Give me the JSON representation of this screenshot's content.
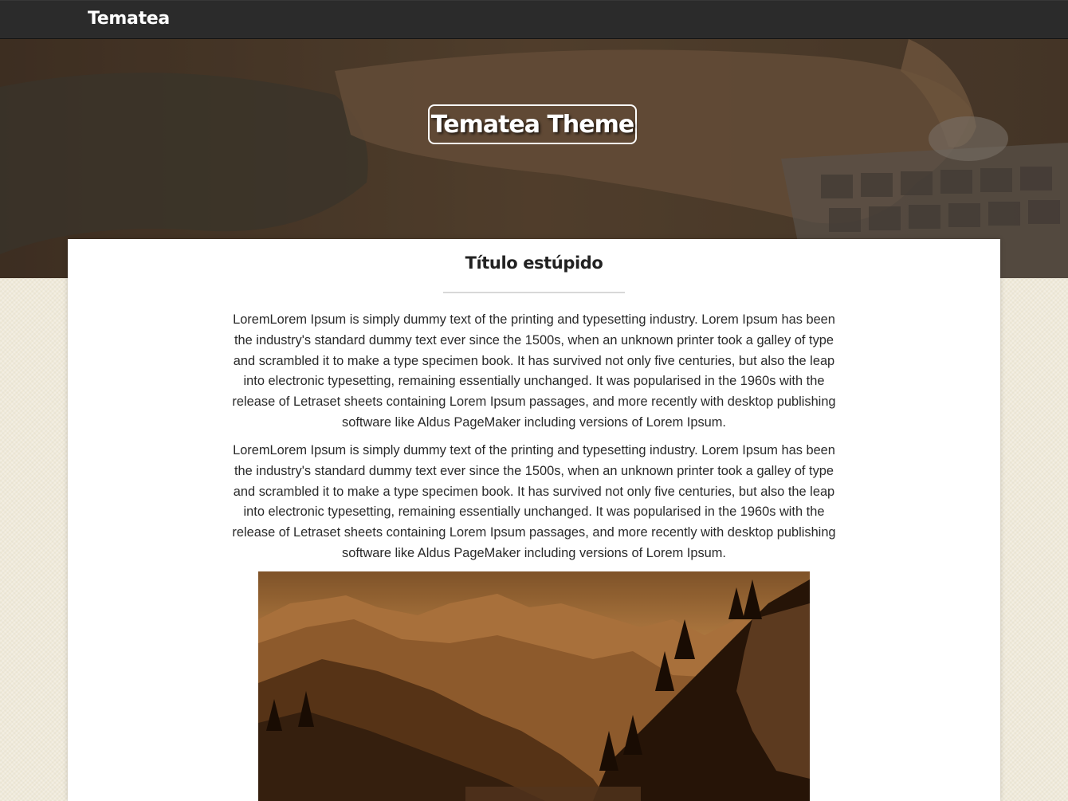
{
  "nav": {
    "brand": "Tematea"
  },
  "hero": {
    "title": "Tematea Theme"
  },
  "content": {
    "title": "Título estúpido",
    "paragraphs": [
      "LoremLorem Ipsum is simply dummy text of the printing and typesetting industry. Lorem Ipsum has been the industry's standard dummy text ever since the 1500s, when an unknown printer took a galley of type and scrambled it to make a type specimen book. It has survived not only five centuries, but also the leap into electronic typesetting, remaining essentially unchanged. It was popularised in the 1960s with the release of Letraset sheets containing Lorem Ipsum passages, and more recently with desktop publishing software like Aldus PageMaker including versions of Lorem Ipsum.",
      "LoremLorem Ipsum is simply dummy text of the printing and typesetting industry. Lorem Ipsum has been the industry's standard dummy text ever since the 1500s, when an unknown printer took a galley of type and scrambled it to make a type specimen book. It has survived not only five centuries, but also the leap into electronic typesetting, remaining essentially unchanged. It was popularised in the 1960s with the release of Letraset sheets containing Lorem Ipsum passages, and more recently with desktop publishing software like Aldus PageMaker including versions of Lorem Ipsum."
    ]
  },
  "colors": {
    "navbar": "#2b2b2b",
    "page_background": "#efe9d8",
    "hero_tint": "#5a4634",
    "photo_tint": "#b8793a"
  }
}
